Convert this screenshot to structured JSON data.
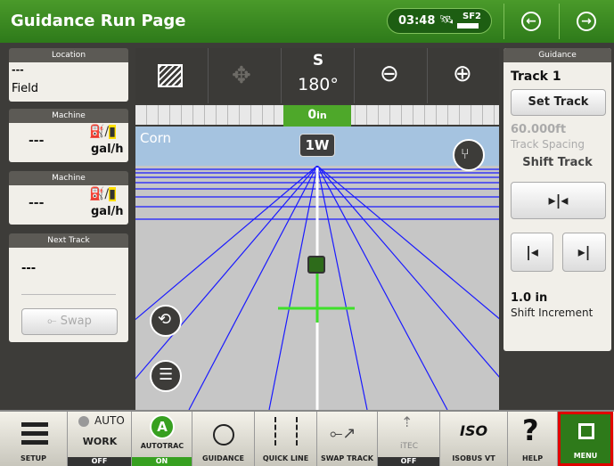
{
  "header": {
    "title": "Guidance Run Page",
    "clock": "03:48",
    "signal_label": "SF2",
    "back_icon": "arrow-left-circle-icon",
    "forward_icon": "arrow-right-circle-icon"
  },
  "left_panel": {
    "location": {
      "header": "Location",
      "value": "---",
      "name": "Field"
    },
    "machine1": {
      "header": "Machine",
      "value": "---",
      "unit": "gal/h"
    },
    "machine2": {
      "header": "Machine",
      "value": "---",
      "unit": "gal/h"
    },
    "next_track": {
      "header": "Next Track",
      "value": "---",
      "swap_label": "Swap"
    }
  },
  "toolbar": {
    "heading_letter": "S",
    "heading_degrees": "180°"
  },
  "view": {
    "offset_value": "0",
    "offset_unit": "in",
    "crop_label": "Corn",
    "mode_badge": "1W"
  },
  "guidance_panel": {
    "header": "Guidance",
    "track_name": "Track 1",
    "set_track_label": "Set Track",
    "spacing_value": "60.000ft",
    "spacing_label": "Track Spacing",
    "shift_track_label": "Shift Track",
    "increment_value": "1.0 in",
    "increment_label": "Shift Increment"
  },
  "dock": {
    "setup": "SETUP",
    "work_auto": "AUTO",
    "work": "WORK",
    "work_status": "OFF",
    "autotrac_letter": "A",
    "autotrac": "AUTOTRAC",
    "autotrac_status": "ON",
    "guidance": "GUIDANCE",
    "quick_line": "QUICK LINE",
    "swap_track": "SWAP TRACK",
    "itec_sub": "iTEC",
    "itec_status": "OFF",
    "iso_logo": "ISO",
    "isobus": "ISOBUS VT",
    "help": "HELP",
    "menu": "MENU"
  },
  "colors": {
    "header_green": "#367f20",
    "panel_dark": "#3d3c39",
    "field_blue": "#1a1aff",
    "line_green": "#3ee02a",
    "menu_highlight": "#e00000"
  }
}
